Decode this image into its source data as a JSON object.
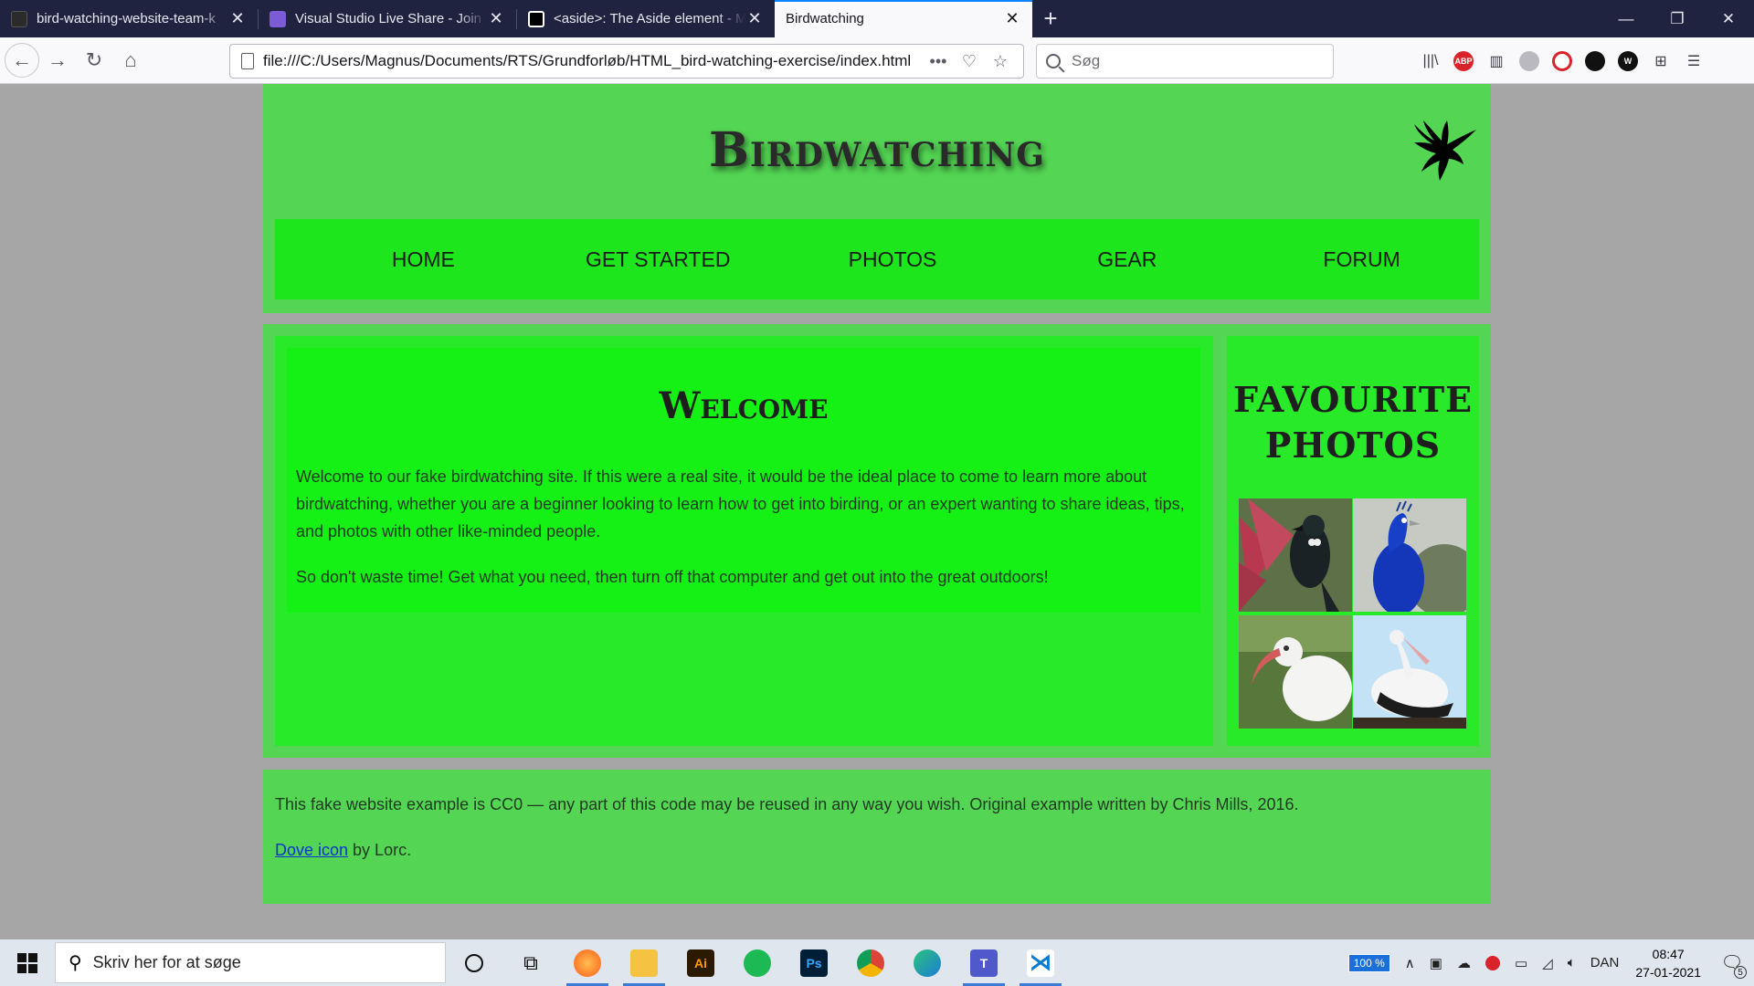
{
  "browser": {
    "tabs": [
      {
        "label": "bird-watching-website-team-k",
        "icon_color": "#2b2b2b"
      },
      {
        "label": "Visual Studio Live Share - Join S",
        "icon_color": "#7b5cd6"
      },
      {
        "label": "<aside>: The Aside element - M",
        "icon_color": "#ffffff"
      },
      {
        "label": "Birdwatching",
        "icon_color": "#f9f9fb"
      }
    ],
    "url": "file:///C:/Users/Magnus/Documents/RTS/Grundforløb/HTML_bird-watching-exercise/index.html",
    "search_placeholder": "Søg"
  },
  "site": {
    "title": "Birdwatching",
    "nav": [
      "HOME",
      "GET STARTED",
      "PHOTOS",
      "GEAR",
      "FORUM"
    ],
    "welcome_heading": "Welcome",
    "welcome_p1": "Welcome to our fake birdwatching site. If this were a real site, it would be the ideal place to come to learn more about birdwatching, whether you are a beginner looking to learn how to get into birding, or an expert wanting to share ideas, tips, and photos with other like-minded people.",
    "welcome_p2": "So don't waste time! Get what you need, then turn off that computer and get out into the great outdoors!",
    "aside_heading": "FAVOURITE PHOTOS",
    "footer_p1": "This fake website example is CC0 — any part of this code may be reused in any way you wish. Original example written by Chris Mills, 2016.",
    "footer_link": "Dove icon",
    "footer_by": " by Lorc.",
    "colors": {
      "header": "#54d654",
      "nav": "#1de61d",
      "article": "#28ea28",
      "welcome": "#15f015"
    }
  },
  "taskbar": {
    "search_placeholder": "Skriv her for at søge",
    "zoom": "100 %",
    "language": "DAN",
    "time": "08:47",
    "date": "27-01-2021",
    "notifications": "5",
    "apps": [
      "firefox",
      "file-explorer",
      "illustrator",
      "spotify",
      "photoshop",
      "chrome",
      "edge",
      "teams",
      "vscode"
    ]
  }
}
